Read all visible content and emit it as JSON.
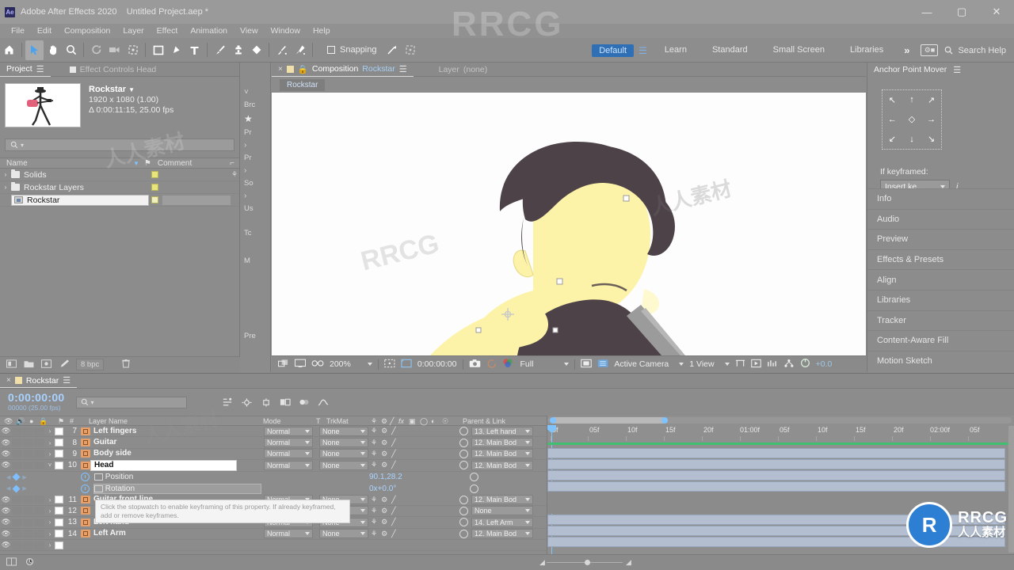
{
  "window": {
    "app_title": "Adobe After Effects 2020",
    "document_title": "Untitled Project.aep *",
    "app_badge": "Ae",
    "minimize": "—",
    "maximize": "▢",
    "close": "✕"
  },
  "menubar": {
    "items": [
      "File",
      "Edit",
      "Composition",
      "Layer",
      "Effect",
      "Animation",
      "View",
      "Window",
      "Help"
    ]
  },
  "toolbar": {
    "tools": [
      {
        "name": "home-icon",
        "title": "Home"
      },
      {
        "name": "selection-tool-icon",
        "title": "Selection Tool"
      },
      {
        "name": "hand-tool-icon",
        "title": "Hand Tool"
      },
      {
        "name": "zoom-tool-icon",
        "title": "Zoom Tool"
      },
      {
        "name": "orbit-tool-icon",
        "title": "Orbit Tool"
      },
      {
        "name": "camera-track-tool-icon",
        "title": "Track Camera"
      },
      {
        "name": "pan-behind-tool-icon",
        "title": "Pan Behind Tool"
      },
      {
        "name": "rectangle-tool-icon",
        "title": "Shape Tool"
      },
      {
        "name": "pen-tool-icon",
        "title": "Pen Tool"
      },
      {
        "name": "type-tool-icon",
        "title": "Type Tool"
      },
      {
        "name": "brush-tool-icon",
        "title": "Brush Tool"
      },
      {
        "name": "clone-stamp-tool-icon",
        "title": "Clone Stamp Tool"
      },
      {
        "name": "eraser-tool-icon",
        "title": "Eraser Tool"
      },
      {
        "name": "roto-brush-tool-icon",
        "title": "Roto Brush Tool"
      },
      {
        "name": "puppet-pin-tool-icon",
        "title": "Puppet Pin Tool"
      }
    ],
    "snapping_label": "Snapping",
    "search_help": "Search Help",
    "overflow": "»",
    "workspaces": [
      {
        "label": "Default",
        "active": true
      },
      {
        "label": "Learn",
        "active": false
      },
      {
        "label": "Standard",
        "active": false
      },
      {
        "label": "Small Screen",
        "active": false
      },
      {
        "label": "Libraries",
        "active": false
      }
    ]
  },
  "project_panel": {
    "tabs": [
      {
        "label": "Project",
        "active": true
      },
      {
        "label": "Effect Controls Head",
        "active": false
      }
    ],
    "item_name": "Rockstar",
    "item_resolution": "1920 x 1080 (1.00)",
    "item_duration": "Δ 0:00:11:15, 25.00 fps",
    "search_placeholder": "",
    "columns": [
      "Name",
      "Comment"
    ],
    "rows": [
      {
        "name": "Solids",
        "type": "folder",
        "selected": false,
        "label_color": "#e8e57a"
      },
      {
        "name": "Rockstar Layers",
        "type": "folder",
        "selected": false,
        "label_color": "#e8e57a"
      },
      {
        "name": "Rockstar",
        "type": "composition",
        "selected": true,
        "label_color": "#e8e57a"
      }
    ],
    "bit_depth": "8 bpc"
  },
  "effect_strip": {
    "labels": [
      "Brc",
      "Pr",
      "Pr",
      "So",
      "Us",
      "Tc",
      "M",
      "Pre"
    ]
  },
  "composition_panel": {
    "tabs": [
      {
        "label": "Composition",
        "value": "Rockstar",
        "active": true
      },
      {
        "label": "Layer",
        "value": "(none)",
        "active": false
      }
    ],
    "breadcrumb": "Rockstar",
    "zoom_level": "200%",
    "timecode": "0:00:00:00",
    "resolution": "Full",
    "view_camera": "Active Camera",
    "view_layout": "1 View",
    "exposure": "+0.0"
  },
  "right_dock": {
    "panel_title": "Anchor Point Mover",
    "keyframe_label": "If keyframed:",
    "keyframe_option": "Insert ke...",
    "info_glyph": "i",
    "arrows": [
      "↖",
      "↑",
      "↗",
      "←",
      "◇",
      "→",
      "↙",
      "↓",
      "↘"
    ],
    "panels": [
      "Info",
      "Audio",
      "Preview",
      "Effects & Presets",
      "Align",
      "Libraries",
      "Tracker",
      "Content-Aware Fill",
      "Motion Sketch"
    ]
  },
  "timeline": {
    "tab_label": "Rockstar",
    "current_time": "0:00:00:00",
    "frame_info": "00000 (25.00 fps)",
    "search_placeholder": "",
    "columns": [
      "Layer Name",
      "Mode",
      "T",
      "TrkMat",
      "Parent & Link"
    ],
    "ruler_ticks": [
      "0f",
      "05f",
      "10f",
      "15f",
      "20f",
      "01:00f",
      "05f",
      "10f",
      "15f",
      "20f",
      "02:00f",
      "05f"
    ],
    "layers": [
      {
        "num": "7",
        "name": "Left fingers",
        "mode": "Normal",
        "trkmat": "None",
        "parent": "13. Left hand",
        "selected": false,
        "expanded": false
      },
      {
        "num": "8",
        "name": "Guitar",
        "mode": "Normal",
        "trkmat": "None",
        "parent": "12. Main Bod",
        "selected": false,
        "expanded": false
      },
      {
        "num": "9",
        "name": "Body side",
        "mode": "Normal",
        "trkmat": "None",
        "parent": "12. Main Bod",
        "selected": false,
        "expanded": false
      },
      {
        "num": "10",
        "name": "Head",
        "mode": "Normal",
        "trkmat": "None",
        "parent": "12. Main Bod",
        "selected": true,
        "expanded": true
      }
    ],
    "properties": [
      {
        "name": "Position",
        "value": "90.1,28.2"
      },
      {
        "name": "Rotation",
        "value": "0x+0.0°"
      }
    ],
    "layers_below": [
      {
        "num": "11",
        "name": "Guitar front line",
        "mode": "Normal",
        "trkmat": "None",
        "parent": "12. Main Bod"
      },
      {
        "num": "12",
        "name": "",
        "mode": "Normal",
        "trkmat": "None",
        "parent": "None"
      },
      {
        "num": "13",
        "name": "Left hand",
        "mode": "Normal",
        "trkmat": "None",
        "parent": "14. Left Arm"
      },
      {
        "num": "14",
        "name": "Left Arm",
        "mode": "Normal",
        "trkmat": "None",
        "parent": "12. Main Bod"
      }
    ],
    "tooltip": "Click the stopwatch to enable keyframing of this property. If already keyframed, add or remove keyframes."
  },
  "watermark": {
    "brand": "RRCG",
    "brand_cn": "人人素材",
    "logo_letter": "R",
    "logo_line1": "RRCG",
    "logo_line2": "人人素材"
  },
  "colors": {
    "accent_blue": "#7fc3ff",
    "workspace_active": "#2f6fb5",
    "label_yellow": "#e8e57a",
    "work_area_green": "#3fbf6f",
    "layer_type_orange": "#e8a06a"
  }
}
